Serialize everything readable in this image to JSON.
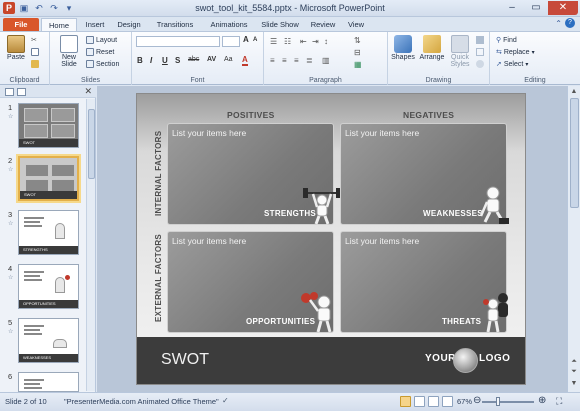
{
  "window": {
    "title": "swot_tool_kit_5584.pptx - Microsoft PowerPoint"
  },
  "tabs": [
    "File",
    "Home",
    "Insert",
    "Design",
    "Transitions",
    "Animations",
    "Slide Show",
    "Review",
    "View"
  ],
  "ribbon": {
    "clipboard": {
      "paste": "Paste",
      "label": "Clipboard"
    },
    "slides": {
      "new_slide": "New Slide",
      "layout": "Layout",
      "reset": "Reset",
      "section": "Section",
      "label": "Slides"
    },
    "font": {
      "label": "Font",
      "bold": "B",
      "italic": "I",
      "underline": "U",
      "strike": "S",
      "shadow": "abc",
      "spacing": "AV",
      "case": "Aa",
      "grow": "A",
      "shrink": "A",
      "clear": "A"
    },
    "paragraph": {
      "label": "Paragraph"
    },
    "drawing": {
      "shapes": "Shapes",
      "arrange": "Arrange",
      "quick_styles": "Quick Styles",
      "label": "Drawing"
    },
    "editing": {
      "find": "Find",
      "replace": "Replace",
      "select": "Select",
      "label": "Editing"
    }
  },
  "thumbnails": {
    "numbers": [
      "1",
      "2",
      "3",
      "4",
      "5",
      "6"
    ],
    "footer_texts": [
      "SWOT",
      "SWOT",
      "STRENGTHS",
      "OPPORTUNITIES",
      "WEAKNESSES",
      ""
    ]
  },
  "slide": {
    "col_positives": "POSITIVES",
    "col_negatives": "NEGATIVES",
    "row_internal": "INTERNAL FACTORS",
    "row_external": "EXTERNAL FACTORS",
    "quadrants": [
      {
        "placeholder": "List your items here",
        "label": "STRENGTHS"
      },
      {
        "placeholder": "List your items here",
        "label": "WEAKNESSES"
      },
      {
        "placeholder": "List your items here",
        "label": "OPPORTUNITIES"
      },
      {
        "placeholder": "List your items here",
        "label": "THREATS"
      }
    ],
    "footer_title": "SWOT",
    "logo_left": "YOUR",
    "logo_right": "LOGO"
  },
  "status": {
    "slide_info": "Slide 2 of 10",
    "theme": "\"PresenterMedia.com Animated Office Theme\"",
    "zoom": "67%",
    "zoom_level": 0.67
  },
  "colors": {
    "file_tab": "#d9562a",
    "accent": "#2b579a"
  }
}
